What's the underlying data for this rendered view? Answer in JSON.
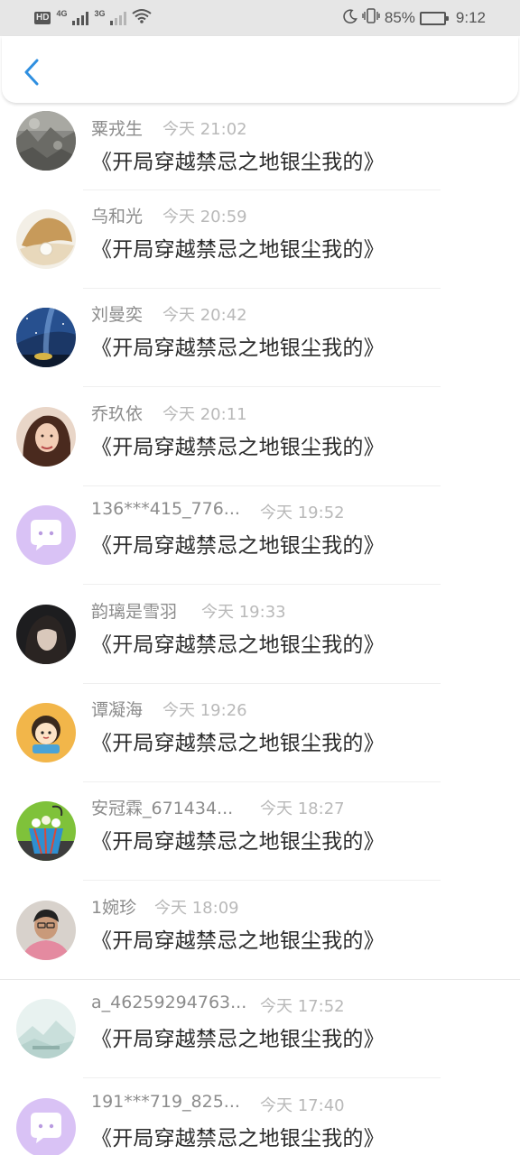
{
  "status_bar": {
    "hd_label": "HD",
    "net1_label": "4G",
    "net2_label": "3G",
    "battery_percent": "85%",
    "time": "9:12"
  },
  "comments": [
    {
      "name": "粟戎生",
      "time": "今天 21:02",
      "text": "《开局穿越禁忌之地银尘我的》",
      "avatar": "rocky-photo-avatar"
    },
    {
      "name": "乌和光",
      "time": "今天 20:59",
      "text": "《开局穿越禁忌之地银尘我的》",
      "avatar": "pearl-shell-avatar"
    },
    {
      "name": "刘曼奕",
      "time": "今天 20:42",
      "text": "《开局穿越禁忌之地银尘我的》",
      "avatar": "starry-sky-avatar"
    },
    {
      "name": "乔玖依",
      "time": "今天 20:11",
      "text": "《开局穿越禁忌之地银尘我的》",
      "avatar": "woman-portrait-avatar"
    },
    {
      "name": "136***415_776...",
      "time": "今天 19:52",
      "text": "《开局穿越禁忌之地银尘我的》",
      "avatar": "default-chat-avatar"
    },
    {
      "name": "韵璃是雪羽",
      "time": "今天 19:33",
      "text": "《开局穿越禁忌之地银尘我的》",
      "avatar": "dark-portrait-avatar"
    },
    {
      "name": "谭凝海",
      "time": "今天 19:26",
      "text": "《开局穿越禁忌之地银尘我的》",
      "avatar": "cartoon-girl-avatar"
    },
    {
      "name": "安冠霖_671434...",
      "time": "今天 18:27",
      "text": "《开局穿越禁忌之地银尘我的》",
      "avatar": "flower-basket-avatar"
    },
    {
      "name": "1婉珍",
      "time": "今天 18:09",
      "text": "《开局穿越禁忌之地银尘我的》",
      "avatar": "man-portrait-avatar"
    },
    {
      "name": "a_46259294763...",
      "time": "今天 17:52",
      "text": "《开局穿越禁忌之地银尘我的》",
      "avatar": "pale-landscape-avatar"
    },
    {
      "name": "191***719_825...",
      "time": "今天 17:40",
      "text": "《开局穿越禁忌之地银尘我的》",
      "avatar": "default-chat-avatar"
    }
  ],
  "colors": {
    "accent": "#2f8fe0",
    "default_avatar": "#d9c2f5",
    "name_text": "#8c8c8c",
    "time_text": "#b9b9b9",
    "comment_text": "#2b2b2b"
  }
}
